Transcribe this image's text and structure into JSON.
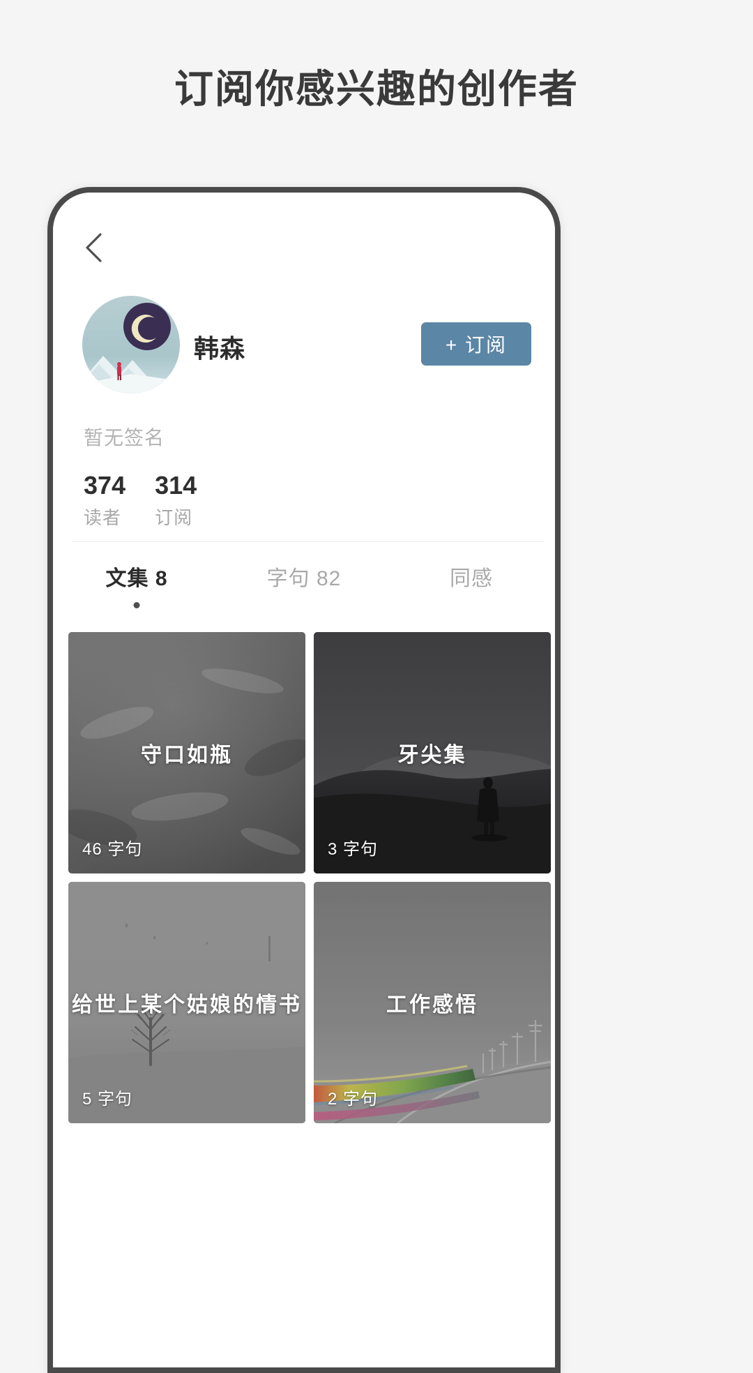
{
  "promo": {
    "headline": "订阅你感兴趣的创作者"
  },
  "nav": {
    "back_icon": "chevron-left-icon"
  },
  "profile": {
    "name": "韩森",
    "avatar_icon": "moon-mountain-avatar",
    "bio": "暂无签名",
    "subscribe_label": "+ 订阅",
    "subscribe_color": "#5b86a6",
    "stats": [
      {
        "value": "374",
        "label": "读者"
      },
      {
        "value": "314",
        "label": "订阅"
      }
    ]
  },
  "tabs": [
    {
      "label": "文集 8",
      "active": true
    },
    {
      "label": "字句 82",
      "active": false
    },
    {
      "label": "同感",
      "active": false
    }
  ],
  "collections": [
    {
      "title": "守口如瓶",
      "count": "46 字句",
      "art": "gray-texture"
    },
    {
      "title": "牙尖集",
      "count": "3 字句",
      "art": "lone-figure-dusk"
    },
    {
      "title": "给世上某个姑娘的情书",
      "count": "5 字句",
      "art": "misty-tree"
    },
    {
      "title": "工作感悟",
      "count": "2 字句",
      "art": "road-light-trails"
    }
  ]
}
